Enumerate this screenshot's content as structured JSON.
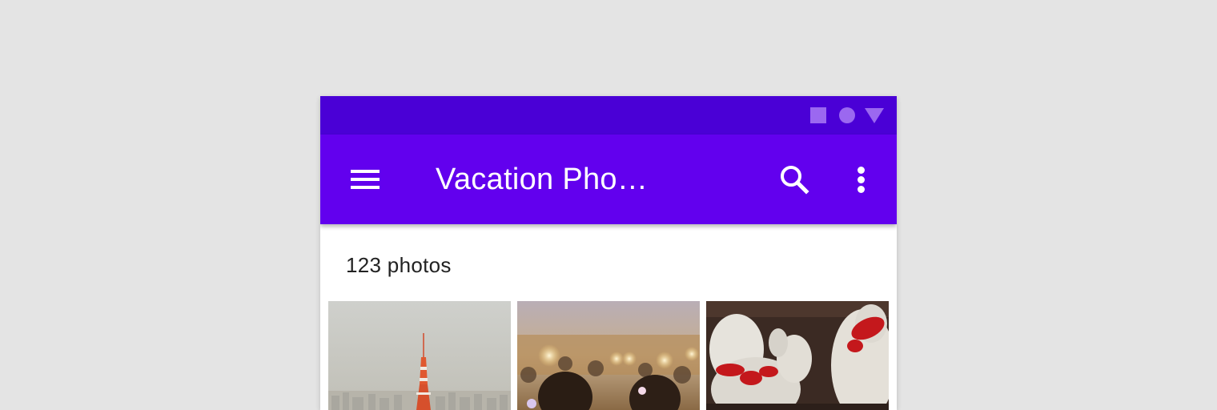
{
  "system": {
    "status_icons": [
      "square-icon",
      "circle-icon",
      "triangle-icon"
    ]
  },
  "app_bar": {
    "title": "Vacation Pho…",
    "icons": [
      "menu-icon",
      "search-icon",
      "more-vert-icon"
    ]
  },
  "content": {
    "count_label": "123 photos",
    "photos": [
      {
        "subject": "tower-cityscape-photo"
      },
      {
        "subject": "festival-crowd-photo"
      },
      {
        "subject": "lucky-cat-figurines-photo"
      }
    ]
  },
  "colors": {
    "background": "#e4e4e4",
    "status_bar": "#4a00d6",
    "app_bar": "#6200ee",
    "status_icon": "#9b68f0",
    "on_primary": "#ffffff"
  }
}
